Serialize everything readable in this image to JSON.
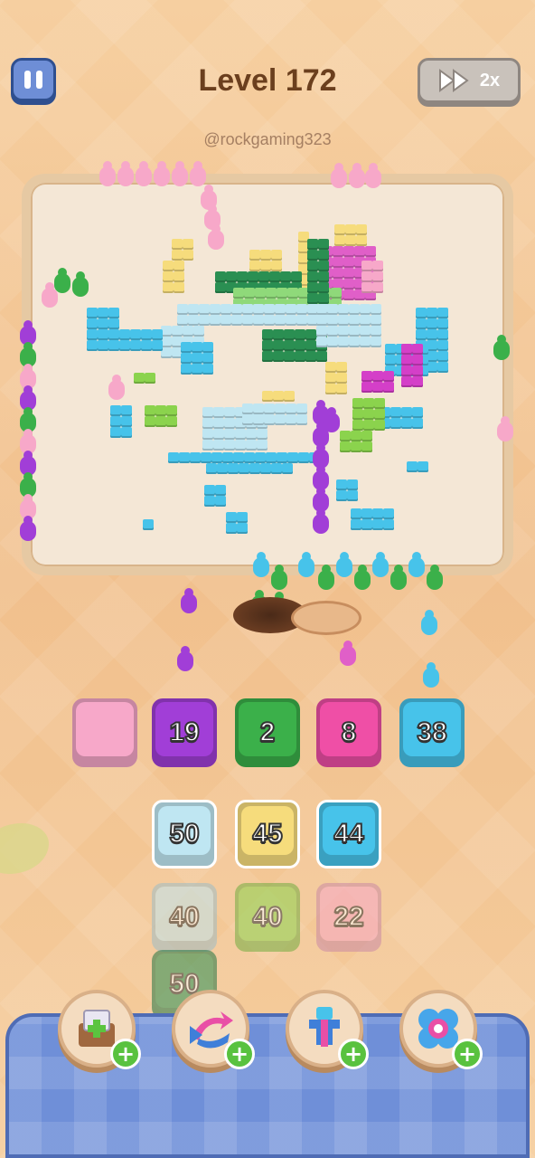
{
  "header": {
    "level_title": "Level 172",
    "watermark": "@rockgaming323",
    "speed_label": "2x"
  },
  "colors": {
    "pink": "#f7a8c9",
    "purple": "#a13ed7",
    "green": "#3bb04a",
    "magenta": "#ef4fa6",
    "cyan": "#47c3ea",
    "light_blue": "#bfe6f2",
    "yellow": "#f6dc7c",
    "lime": "#8bd34d",
    "dark_green": "#2a8f52"
  },
  "slots": [
    {
      "value": "",
      "color": "#f7a8c9"
    },
    {
      "value": "19",
      "color": "#a13ed7"
    },
    {
      "value": "2",
      "color": "#3bb04a"
    },
    {
      "value": "8",
      "color": "#ef4fa6"
    },
    {
      "value": "38",
      "color": "#47c3ea"
    }
  ],
  "queue": {
    "col1": [
      {
        "value": "50",
        "color": "#bfe6f2"
      },
      {
        "value": "40",
        "color": "#bfe6f2"
      },
      {
        "value": "50",
        "color": "#2a8f52"
      }
    ],
    "col2": [
      {
        "value": "45",
        "color": "#f6dc7c"
      },
      {
        "value": "40",
        "color": "#8bd34d"
      }
    ],
    "col3": [
      {
        "value": "44",
        "color": "#47c3ea"
      },
      {
        "value": "22",
        "color": "#f7a8c9"
      }
    ]
  },
  "boosters": [
    {
      "icon": "add-box-icon"
    },
    {
      "icon": "shuffle-arrows-icon"
    },
    {
      "icon": "magnet-claw-icon"
    },
    {
      "icon": "flower-bomb-icon"
    }
  ]
}
